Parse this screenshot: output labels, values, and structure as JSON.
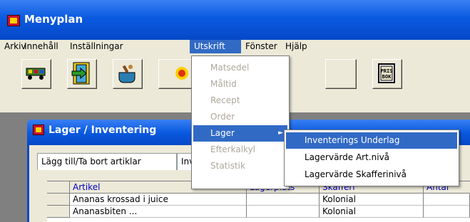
{
  "window": {
    "title": "Menyplan"
  },
  "menubar": {
    "items": [
      "Arkiv",
      "Innehåll",
      "Inställningar",
      "Utskrift",
      "Fönster",
      "Hjälp"
    ],
    "active": "Utskrift"
  },
  "utskrift_menu": {
    "items": [
      "Matsedel",
      "Måltid",
      "Recept",
      "Order",
      "Lager",
      "Efterkalkyl",
      "Statistik"
    ],
    "highlighted": "Lager",
    "submenu_arrow": "►"
  },
  "lager_submenu": {
    "items": [
      "Inventerings Underlag",
      "Lagervärde Art.nivå",
      "Lagervärde Skafferinivå"
    ],
    "highlighted": "Inventerings Underlag"
  },
  "child_window": {
    "title": "Lager / Inventering",
    "tabs": [
      "Lägg till/Ta bort artiklar",
      "Inv"
    ]
  },
  "grid": {
    "columns": [
      "Artikel",
      "Lagerplats",
      "Skafferi",
      "Antal"
    ],
    "rows": [
      [
        "Ananas krossad i juice",
        "",
        "Kolonial",
        ""
      ],
      [
        "Ananasbiten ...",
        "",
        "Kolonial",
        ""
      ]
    ]
  },
  "toolbar": {
    "icons": [
      "train-car-icon",
      "door-exit-icon",
      "cooking-pot-icon",
      "fire-icon",
      "blank-button",
      "prisbok-icon"
    ],
    "prisbok_label": "PRIS\nBOK"
  },
  "colors": {
    "titlebar": "#0a5ae0",
    "menu_highlight": "#316ac5",
    "chrome": "#ece9d8",
    "disabled_text": "#aca899"
  }
}
